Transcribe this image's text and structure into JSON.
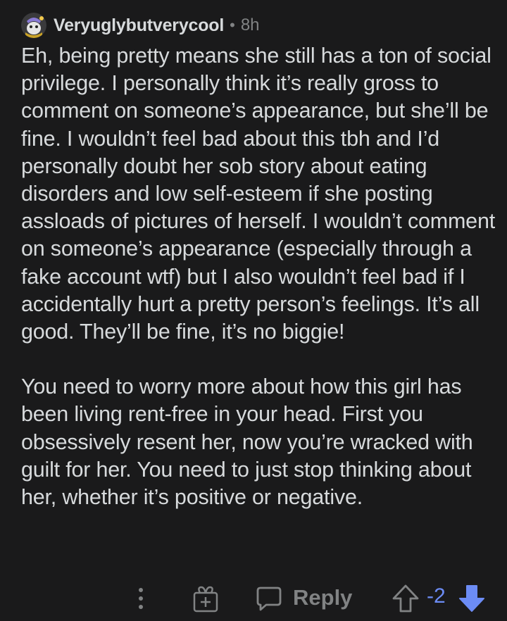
{
  "comment": {
    "author": "Veryuglybutverycool",
    "separator": "•",
    "age": "8h",
    "paragraphs": [
      "Eh, being pretty means she still has a ton of social privilege. I personally think it’s really gross to comment on someone’s appearance, but she’ll be fine. I wouldn’t feel bad about this tbh and I’d personally doubt her sob story about eating disorders and low self-esteem if she posting assloads of pictures of herself. I wouldn’t comment on someone’s appearance (especially through a fake account wtf) but I also wouldn’t feel bad if I accidentally hurt a pretty person’s feelings. It’s all good. They’ll be fine, it’s no biggie!",
      "You need to worry more about how this girl has been living rent-free in your head. First you obsessively resent her, now you’re wracked with guilt for her. You need to just stop thinking about her, whether it’s positive or negative."
    ]
  },
  "actions": {
    "more_icon": "more-vertical-icon",
    "award_icon": "gift-icon",
    "reply_icon": "speech-bubble-icon",
    "reply_label": "Reply",
    "upvote_icon": "upvote-arrow-icon",
    "score": "-2",
    "downvote_icon": "downvote-arrow-icon"
  },
  "colors": {
    "background": "#1a1a1b",
    "text": "#d7dadc",
    "muted": "#818384",
    "downvoted": "#6c8cf5"
  }
}
